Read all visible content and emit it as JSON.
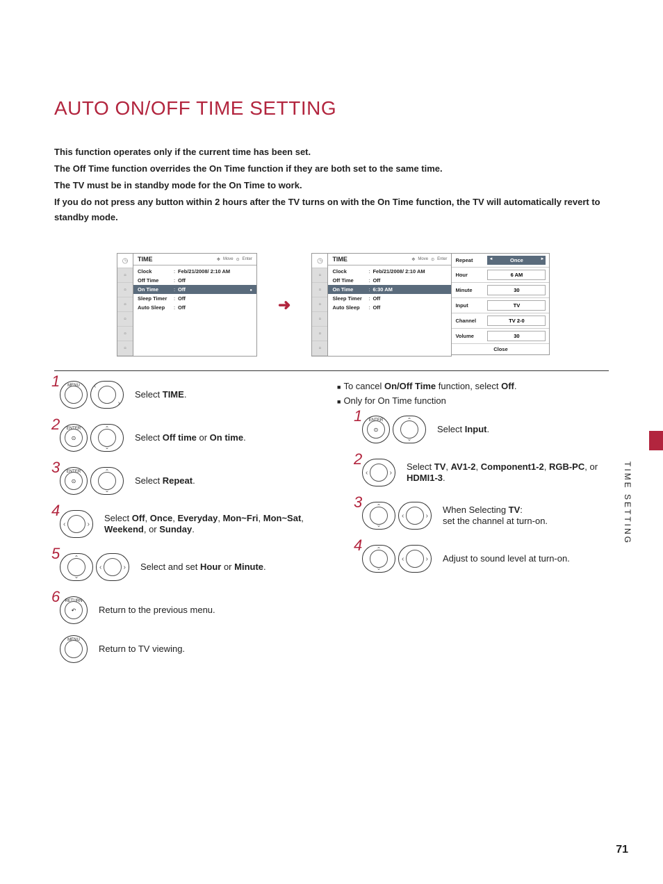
{
  "title": "AUTO ON/OFF TIME SETTING",
  "intro": {
    "l1": "This function operates only if the current time has been set.",
    "l2a": "The ",
    "l2b": "Off Time",
    "l2c": " function overrides the ",
    "l2d": "On Time",
    "l2e": " function if they are both set to the same time.",
    "l3a": "The TV must be in standby mode for the ",
    "l3b": "On Time",
    "l3c": " to work.",
    "l4a": "If you do not press any button within 2 hours after the TV turns on with the ",
    "l4b": "On Time",
    "l4c": " function, the TV will automatically revert to standby mode."
  },
  "osd": {
    "header": "TIME",
    "hint_move": "Move",
    "hint_enter": "Enter",
    "clock_label": "Clock",
    "clock_value": "Feb/21/2008/  2:10 AM",
    "off_label": "Off Time",
    "off_value": "Off",
    "on_label": "On Time",
    "on_value_a": "Off",
    "on_value_b": "6:30 AM",
    "sleep_label": "Sleep Timer",
    "sleep_value": "Off",
    "auto_label": "Auto Sleep",
    "auto_value": "Off"
  },
  "subpanel": {
    "repeat_l": "Repeat",
    "repeat_v": "Once",
    "hour_l": "Hour",
    "hour_v": "6 AM",
    "minute_l": "Minute",
    "minute_v": "30",
    "input_l": "Input",
    "input_v": "TV",
    "channel_l": "Channel",
    "channel_v": "TV 2-0",
    "volume_l": "Volume",
    "volume_v": "30",
    "close": "Close"
  },
  "steps_left": {
    "s1_btn": "MENU",
    "s1_a": "Select ",
    "s1_b": "TIME",
    "s1_c": ".",
    "s2_btn": "ENTER",
    "s2_a": "Select ",
    "s2_b": "Off time",
    "s2_c": " or ",
    "s2_d": "On time",
    "s2_e": ".",
    "s3_btn": "ENTER",
    "s3_a": "Select ",
    "s3_b": "Repeat",
    "s3_c": ".",
    "s4_a": "Select ",
    "s4_b": "Off",
    "s4_c": ", ",
    "s4_d": "Once",
    "s4_e": ", ",
    "s4_f": "Everyday",
    "s4_g": ", ",
    "s4_h": "Mon~Fri",
    "s4_i": ", ",
    "s4_j": "Mon~Sat",
    "s4_k": ", ",
    "s4_l": "Weekend",
    "s4_m": ", or ",
    "s4_n": "Sunday",
    "s4_o": ".",
    "s5_a": "Select and set ",
    "s5_b": "Hour",
    "s5_c": " or ",
    "s5_d": "Minute",
    "s5_e": ".",
    "s6_btn": "RETURN",
    "s6_t": "Return to the previous menu.",
    "s7_btn": "MENU",
    "s7_t": "Return to TV viewing."
  },
  "bullets": {
    "b1a": "To cancel ",
    "b1b": "On/Off Time",
    "b1c": " function, select ",
    "b1d": "Off",
    "b1e": ".",
    "b2": "Only for On Time function"
  },
  "steps_right": {
    "s1_btn": "ENTER",
    "s1_a": "Select ",
    "s1_b": "Input",
    "s1_c": ".",
    "s2_a": "Select ",
    "s2_b": "TV",
    "s2_c": ", ",
    "s2_d": "AV1-2",
    "s2_e": ", ",
    "s2_f": "Component1-2",
    "s2_g": ", ",
    "s2_h": "RGB-PC",
    "s2_i": ", or ",
    "s2_j": "HDMI1-3",
    "s2_k": ".",
    "s3_a": "When Selecting ",
    "s3_b": "TV",
    "s3_c": ":",
    "s3_d": "set the channel at turn-on.",
    "s4_t": "Adjust to sound level at turn-on."
  },
  "side_tab": "TIME SETTING",
  "page_num": "71"
}
